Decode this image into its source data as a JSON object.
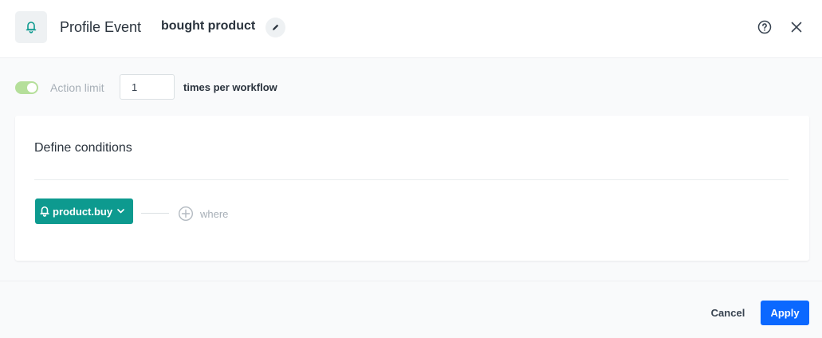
{
  "header": {
    "title": "Profile Event",
    "subtitle": "bought product",
    "icons": {
      "event": "bell-icon",
      "edit": "pencil-icon",
      "help": "question-circle-icon",
      "close": "close-icon"
    }
  },
  "action_limit": {
    "enabled": true,
    "label": "Action limit",
    "value": "1",
    "suffix": "times per workflow"
  },
  "conditions": {
    "title": "Define conditions",
    "event_chip": {
      "label": "product.buy",
      "icon": "bell-icon",
      "caret": "chevron-down-icon"
    },
    "where": {
      "label": "where",
      "icon": "plus-circle-icon"
    }
  },
  "footer": {
    "cancel_label": "Cancel",
    "apply_label": "Apply"
  },
  "colors": {
    "accent": "#0b68ff",
    "teal": "#0d9a8f",
    "toggle_on": "#b5df9a"
  }
}
